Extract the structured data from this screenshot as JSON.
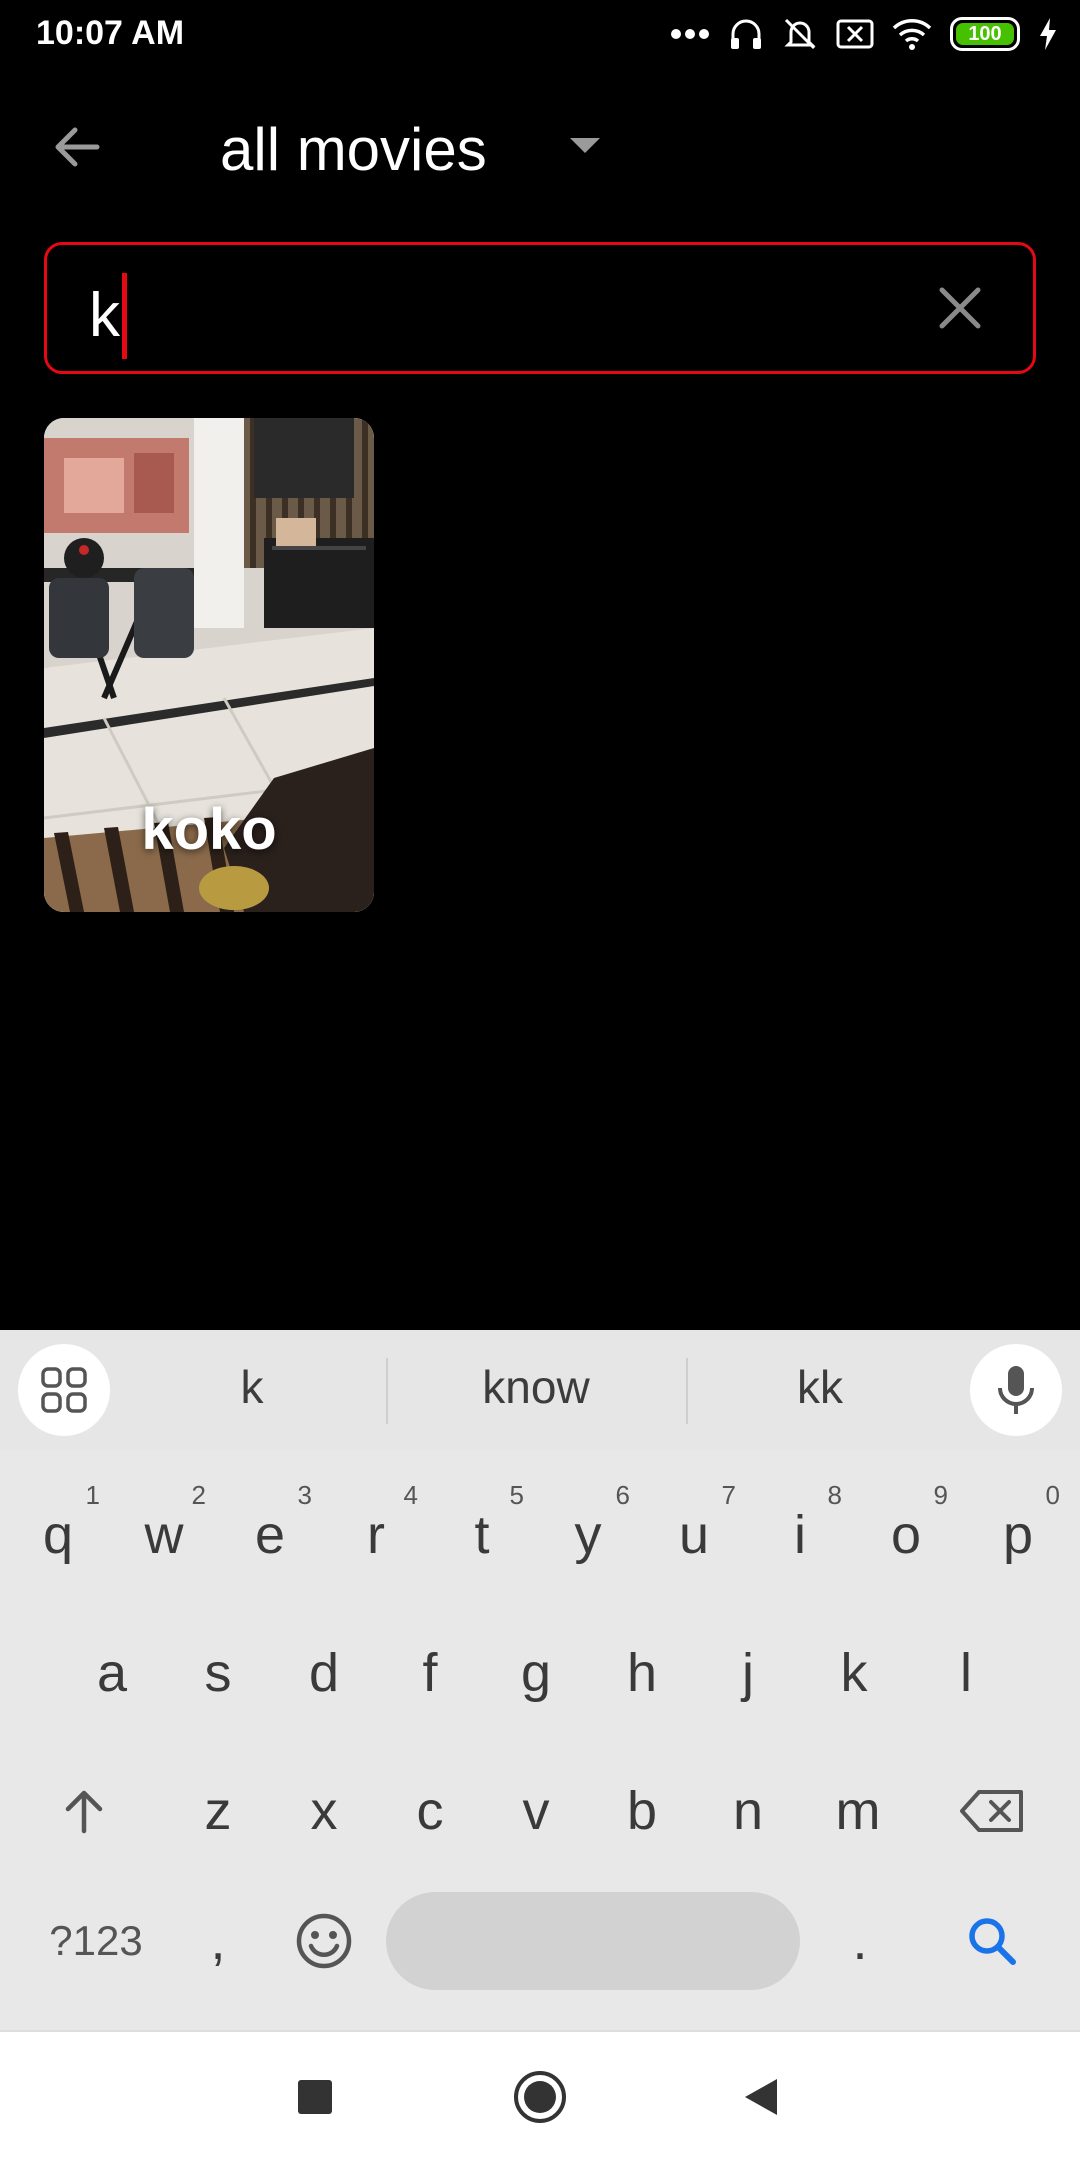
{
  "status_bar": {
    "time": "10:07 AM",
    "battery_level": "100",
    "icons": [
      "more-dots-icon",
      "headset-icon",
      "bell-off-icon",
      "sim-off-icon",
      "wifi-icon",
      "battery-icon",
      "charging-bolt-icon"
    ]
  },
  "toolbar": {
    "title": "all movies",
    "back_icon": "arrow-back-icon",
    "dropdown_icon": "caret-down-icon"
  },
  "search": {
    "value": "k",
    "clear_icon": "close-icon"
  },
  "results": [
    {
      "title": "koko"
    }
  ],
  "keyboard": {
    "suggestions": [
      "k",
      "know",
      "kk"
    ],
    "row1": [
      {
        "label": "q",
        "hint": "1"
      },
      {
        "label": "w",
        "hint": "2"
      },
      {
        "label": "e",
        "hint": "3"
      },
      {
        "label": "r",
        "hint": "4"
      },
      {
        "label": "t",
        "hint": "5"
      },
      {
        "label": "y",
        "hint": "6"
      },
      {
        "label": "u",
        "hint": "7"
      },
      {
        "label": "i",
        "hint": "8"
      },
      {
        "label": "o",
        "hint": "9"
      },
      {
        "label": "p",
        "hint": "0"
      }
    ],
    "row2": [
      "a",
      "s",
      "d",
      "f",
      "g",
      "h",
      "j",
      "k",
      "l"
    ],
    "row3": [
      "z",
      "x",
      "c",
      "v",
      "b",
      "n",
      "m"
    ],
    "symbols_label": "?123",
    "comma_label": ",",
    "period_label": ".",
    "accent_color": "#1a73e8"
  },
  "colors": {
    "accent": "#e50914",
    "background": "#000000",
    "battery": "#46c000"
  }
}
